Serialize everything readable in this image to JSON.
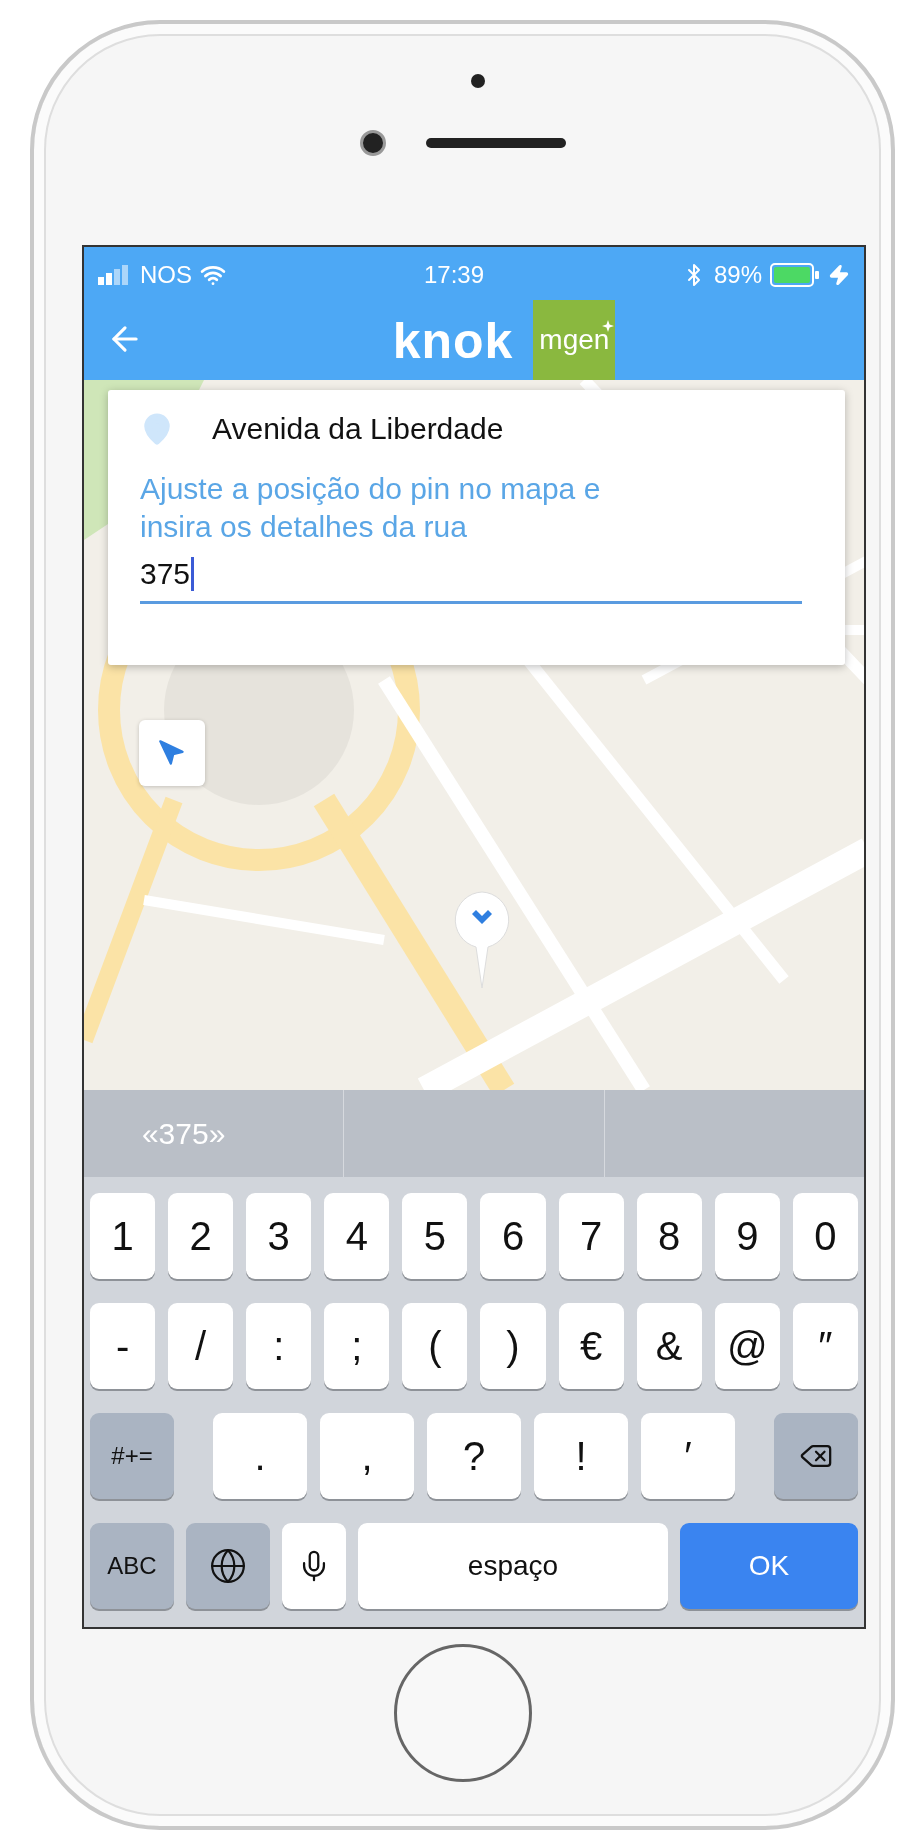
{
  "status_bar": {
    "carrier": "NOS",
    "time": "17:39",
    "battery": "89%"
  },
  "header": {
    "logo": "knok",
    "partner_logo": "mgen"
  },
  "address_card": {
    "address": "Avenida da Liberdade",
    "instruction": "Ajuste a posição do pin no mapa e insira os detalhes da rua",
    "field": {
      "value": "375",
      "focused": true
    }
  },
  "keyboard": {
    "suggestions": [
      "«375»"
    ],
    "rows": [
      [
        {
          "kind": "char",
          "label": "1"
        },
        {
          "kind": "char",
          "label": "2"
        },
        {
          "kind": "char",
          "label": "3"
        },
        {
          "kind": "char",
          "label": "4"
        },
        {
          "kind": "char",
          "label": "5"
        },
        {
          "kind": "char",
          "label": "6"
        },
        {
          "kind": "char",
          "label": "7"
        },
        {
          "kind": "char",
          "label": "8"
        },
        {
          "kind": "char",
          "label": "9"
        },
        {
          "kind": "char",
          "label": "0"
        }
      ],
      [
        {
          "kind": "char",
          "label": "-"
        },
        {
          "kind": "char",
          "label": "/"
        },
        {
          "kind": "char",
          "label": ":"
        },
        {
          "kind": "char",
          "label": ";"
        },
        {
          "kind": "char",
          "label": "("
        },
        {
          "kind": "char",
          "label": ")"
        },
        {
          "kind": "char",
          "label": "€"
        },
        {
          "kind": "char",
          "label": "&"
        },
        {
          "kind": "char",
          "label": "@"
        },
        {
          "kind": "char",
          "label": "″"
        }
      ],
      [
        {
          "kind": "function",
          "label": "#+="
        },
        {
          "kind": "char",
          "label": "."
        },
        {
          "kind": "char",
          "label": ","
        },
        {
          "kind": "char",
          "label": "?"
        },
        {
          "kind": "char",
          "label": "!"
        },
        {
          "kind": "char",
          "label": "′"
        },
        {
          "kind": "backspace"
        }
      ],
      [
        {
          "kind": "function",
          "label": "ABC"
        },
        {
          "kind": "globe"
        },
        {
          "kind": "mic"
        },
        {
          "kind": "space",
          "label": "espaço"
        },
        {
          "kind": "return",
          "label": "OK"
        }
      ]
    ]
  }
}
